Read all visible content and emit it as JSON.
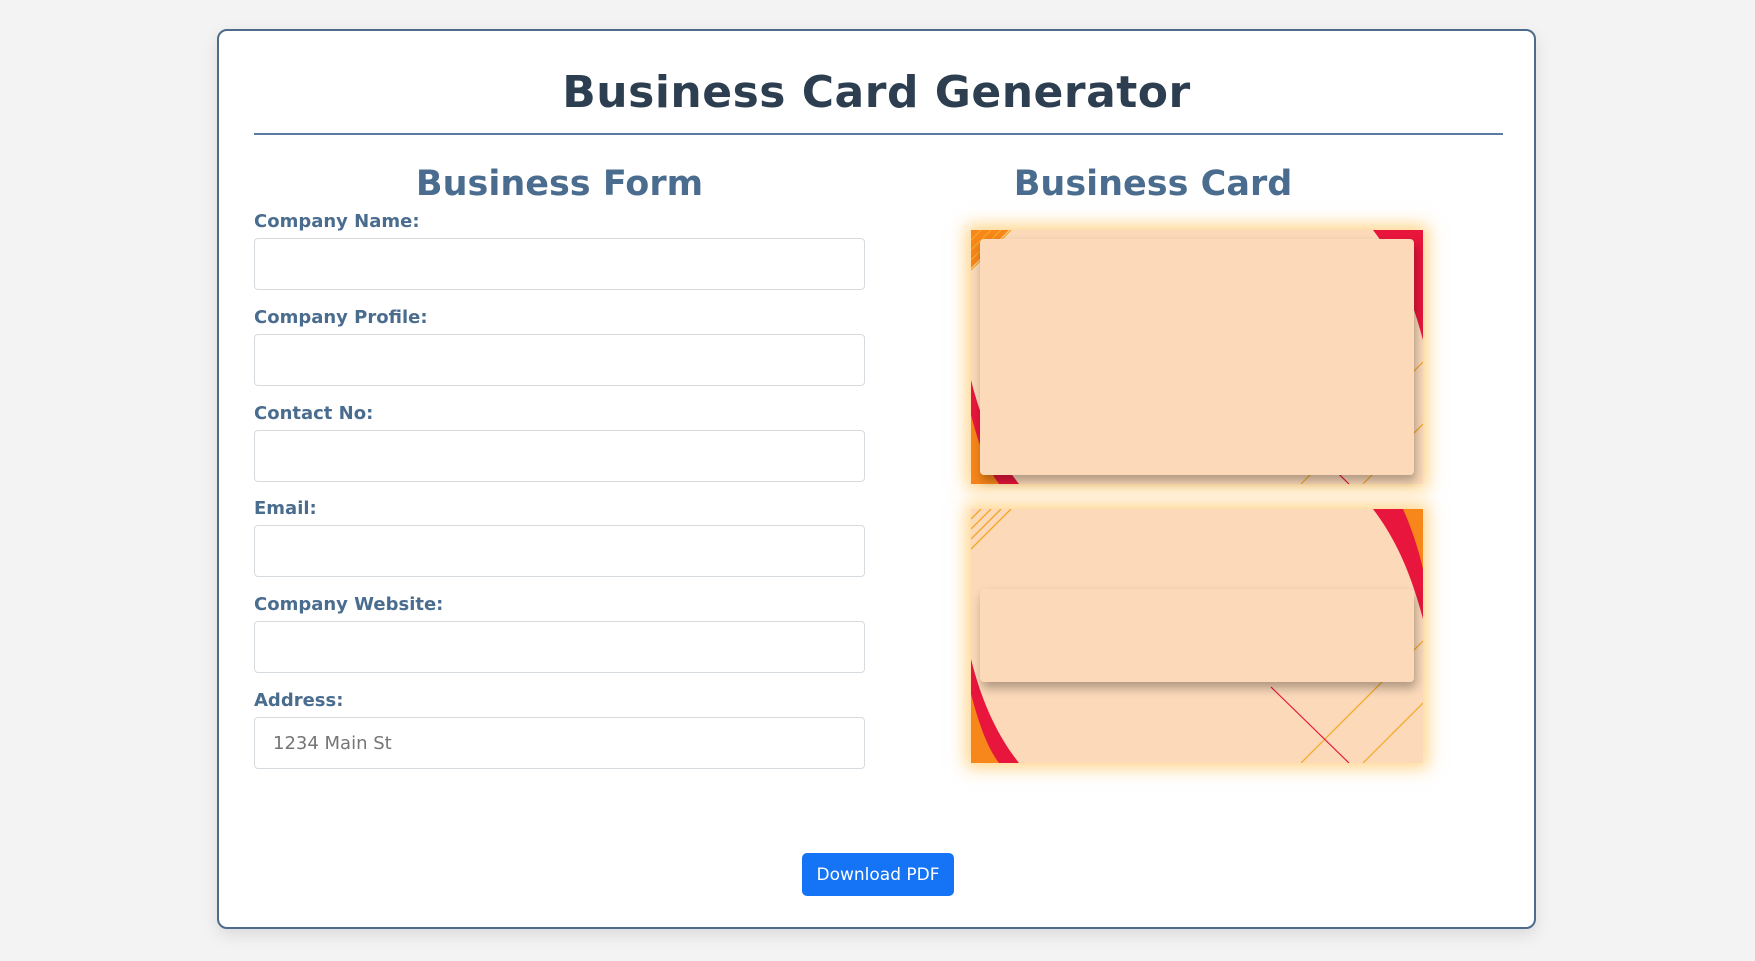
{
  "header": {
    "title": "Business Card Generator"
  },
  "form": {
    "heading": "Business Form",
    "fields": [
      {
        "label": "Company Name:",
        "value": "",
        "placeholder": ""
      },
      {
        "label": "Company Profile:",
        "value": "",
        "placeholder": ""
      },
      {
        "label": "Contact No:",
        "value": "",
        "placeholder": ""
      },
      {
        "label": "Email:",
        "value": "",
        "placeholder": ""
      },
      {
        "label": "Company Website:",
        "value": "",
        "placeholder": ""
      },
      {
        "label": "Address:",
        "value": "",
        "placeholder": "1234 Main St"
      }
    ]
  },
  "card": {
    "heading": "Business Card"
  },
  "actions": {
    "download_label": "Download PDF"
  },
  "colors": {
    "page_background": "#f3f3f3",
    "panel_border": "#4f6b8c",
    "title_text": "#2c3e50",
    "heading_text": "#4a6d8f",
    "card_peach": "#fbd9b9",
    "card_orange": "#f7861b",
    "card_red": "#e8163c",
    "card_glow": "#ffb028",
    "button_blue": "#1573f5"
  }
}
